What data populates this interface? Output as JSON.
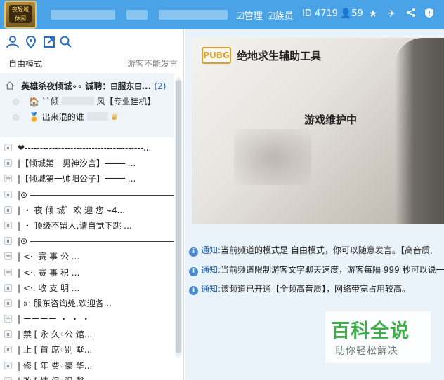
{
  "header": {
    "logo_lines": [
      "夜轻城",
      "休闲"
    ],
    "nav": [
      "管理",
      "族员"
    ],
    "id_label": "ID 4719",
    "online": "59"
  },
  "toolbar": {
    "mode": "自由模式",
    "guest_notice": "游客不能发言"
  },
  "tree": {
    "root_name": "英雄杀夜倾城∘∘ 诚聘：⊟服东⊟...",
    "root_count": "(2)",
    "members": [
      "``倾",
      "出来混的谁"
    ],
    "member_suffix": "风【专业挂机】",
    "channels": [
      {
        "icon": "lock",
        "label": "❤---------------------------------------..."
      },
      {
        "icon": "lock",
        "label": "|【倾城第一男神汐言】━━━━ ..."
      },
      {
        "icon": "plus",
        "label": "|【倾城第一帅阳公子】━━━━ ..."
      },
      {
        "icon": "lock",
        "label": "|⊙ ―――――――――――――――――――..."
      },
      {
        "icon": "lock",
        "label": "|  ・   夜 倾 城゜欢 迎 您 ⌁4..."
      },
      {
        "icon": "lock",
        "label": "|  ・   顶级不留人,请自觉下跳 ..."
      },
      {
        "icon": "lock",
        "label": "|⊙ ―――――――――――――――――――..."
      },
      {
        "icon": "plus",
        "label": "|               <·. 赛  事  公  ..."
      },
      {
        "icon": "plus",
        "label": "|               <·. 赛  事  积  ..."
      },
      {
        "icon": "lock",
        "label": "|               <·. 收  支  明  ..."
      },
      {
        "icon": "lock",
        "label": "|         »:  服东咨询处,欢迎各..."
      },
      {
        "icon": "plus",
        "label": "|               ーーーー  ・ ・ ・"
      },
      {
        "icon": "lock",
        "label": "|   禁       [   永  久◦公  馆..."
      },
      {
        "icon": "lock",
        "label": "|   止       [   首  席◦别  墅..."
      },
      {
        "icon": "lock",
        "label": "|   修       [   年  费◦豪  华..."
      },
      {
        "icon": "lock",
        "label": "|   改       [   情  侣◦温  馨..."
      }
    ]
  },
  "content": {
    "brand": "PUBG",
    "banner_title": "绝地求生辅助工具",
    "maintenance": "游戏维护中",
    "notices": [
      {
        "tag": "通知:",
        "text": "当前频道的模式是 自由模式，你可以随意发言。【高音质,"
      },
      {
        "tag": "通知:",
        "text": "当前频道限制游客文字聊天速度，游客每隔 999 秒可以说一"
      },
      {
        "tag": "通知:",
        "text": "该频道已开通【全频高音质】，网络带宽占用较高。"
      }
    ],
    "watermark_main": "百科全说",
    "watermark_sub": "助你轻松解决"
  },
  "colors": {
    "header_bg": "#4aa3e6",
    "content_bg": "#eaf3fa",
    "accent_blue": "#2a6fc0",
    "watermark_green": "#3fae4a"
  }
}
